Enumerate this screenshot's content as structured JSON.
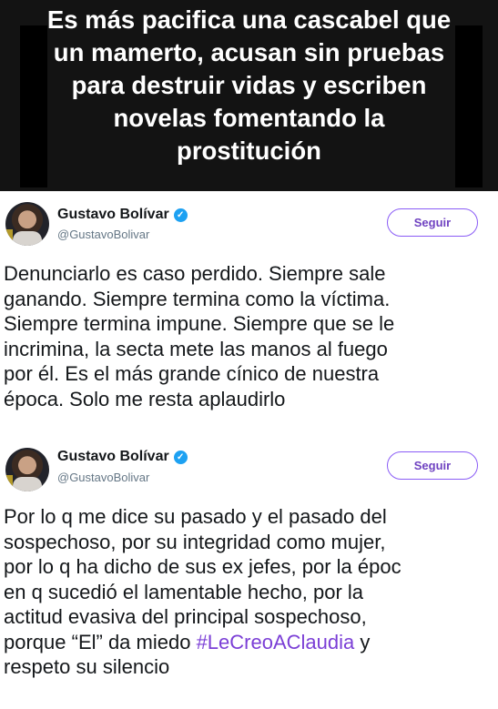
{
  "banner": {
    "text": "Es más pacifica una cascabel que un mamerto, acusan sin pruebas para destruir vidas y escriben novelas fomentando la prostitución"
  },
  "tweets": [
    {
      "display_name": "Gustavo Bolívar",
      "handle": "@GustavoBolivar",
      "follow_label": "Seguir",
      "text_lines": [
        "Denunciarlo es caso perdido. Siempre sale",
        "ganando. Siempre termina como la víctima.",
        "Siempre termina impune. Siempre que se le",
        "incrimina, la secta mete las manos al fuego",
        "por él. Es el más grande cínico de nuestra",
        "época. Solo me resta aplaudirlo"
      ]
    },
    {
      "display_name": "Gustavo Bolívar",
      "handle": "@GustavoBolivar",
      "follow_label": "Seguir",
      "text_lines": [
        "Por lo q me dice su pasado y el pasado del",
        "sospechoso, por su integridad como mujer,",
        "por lo q ha dicho de sus ex jefes, por la époc",
        "en q sucedió el lamentable hecho, por la",
        "actitud evasiva del principal sospechoso,",
        "porque “El” da miedo ",
        "respeto su silencio"
      ],
      "hashtag": "#LeCreoAClaudia",
      "after_hashtag": " y"
    }
  ],
  "colors": {
    "banner_bg": "#131313",
    "hashtag": "#7b3fd6",
    "verified": "#1da1f2",
    "follow_border": "#8a5cf6"
  },
  "icons": {
    "verified": "verified-badge-icon"
  }
}
